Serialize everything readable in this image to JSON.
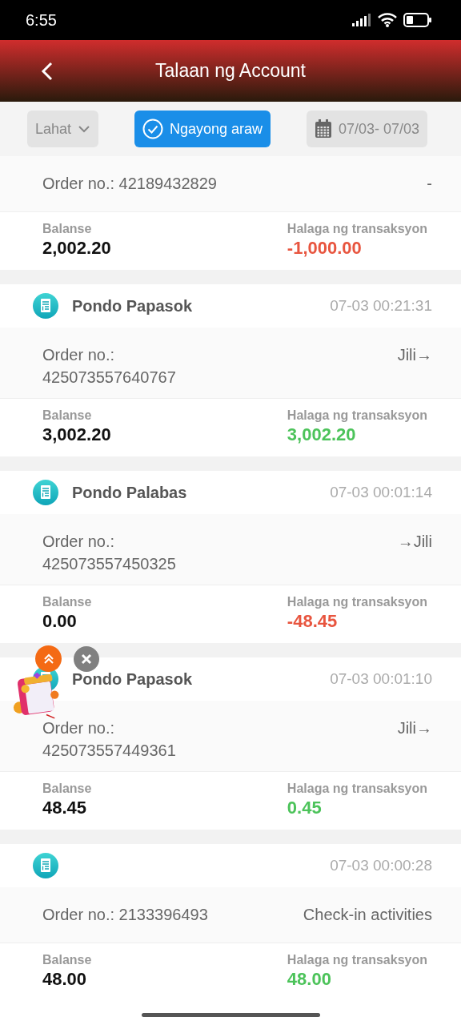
{
  "status_bar": {
    "time": "6:55"
  },
  "header": {
    "title": "Talaan ng Account"
  },
  "filters": [
    {
      "kind": "dropdown",
      "label": "Lahat",
      "selected": false
    },
    {
      "kind": "toggle",
      "label": "Ngayong araw",
      "selected": true
    },
    {
      "kind": "date",
      "label": "07/03- 07/03",
      "selected": false
    }
  ],
  "records": [
    {
      "order": "Order no.: 42189432829",
      "note": "-",
      "balance_label": "Balanse",
      "balance": "2,002.20",
      "amount_label": "Halaga ng transaksyon",
      "amount": "-1,000.00",
      "kind": "debit"
    },
    {
      "title": "Pondo Papasok",
      "time": "07-03 00:21:31",
      "order": "Order no.: 425073557640767",
      "note": "Jili→",
      "balance_label": "Balanse",
      "balance": "3,002.20",
      "amount_label": "Halaga ng transaksyon",
      "amount": "3,002.20",
      "kind": "credit"
    },
    {
      "title": "Pondo Palabas",
      "time": "07-03 00:01:14",
      "order": "Order no.: 425073557450325",
      "note": "→Jili",
      "balance_label": "Balanse",
      "balance": "0.00",
      "amount_label": "Halaga ng transaksyon",
      "amount": "-48.45",
      "kind": "debit"
    },
    {
      "title": "Pondo Papasok",
      "time": "07-03 00:01:10",
      "order": "Order no.: 425073557449361",
      "note": "Jili→",
      "balance_label": "Balanse",
      "balance": "48.45",
      "amount_label": "Halaga ng transaksyon",
      "amount": "0.45",
      "kind": "credit"
    },
    {
      "time": "07-03 00:00:28",
      "order": "Order no.: 2133396493",
      "note": "Check-in activities",
      "balance_label": "Balanse",
      "balance": "48.00",
      "amount_label": "Halaga ng transaksyon",
      "amount": "48.00",
      "kind": "credit"
    }
  ]
}
